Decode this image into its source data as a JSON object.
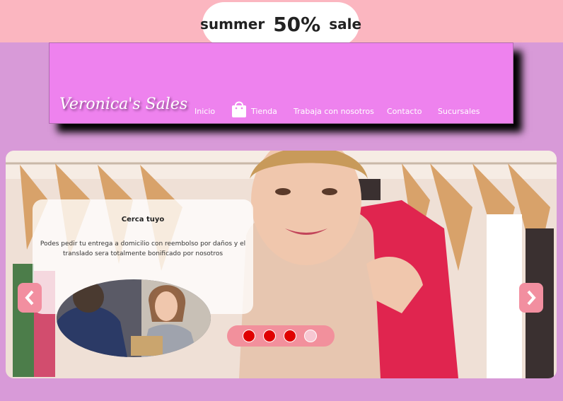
{
  "promo": {
    "prefix": "summer",
    "percent": "50%",
    "suffix": "sale"
  },
  "brand": "Veronica's Sales",
  "nav": [
    {
      "label": "Inicio"
    },
    {
      "label": "Tienda",
      "icon": "shopping-bag-icon"
    },
    {
      "label": "Trabaja con nosotros"
    },
    {
      "label": "Contacto"
    },
    {
      "label": "Sucursales"
    }
  ],
  "slide": {
    "title": "Cerca tuyo",
    "text": "Podes pedir tu entrega a domicilio con reembolso por daños y el translado sera totalmente bonificado por nosotros"
  },
  "slider": {
    "total_slides": 4,
    "active_slide": 4
  },
  "colors": {
    "background": "#d89ad8",
    "topbar": "#fbb6c0",
    "header": "#ee82ee",
    "accent": "#f28fa0",
    "dot_inactive": "#e00000",
    "dot_active": "#f7c7d2"
  }
}
